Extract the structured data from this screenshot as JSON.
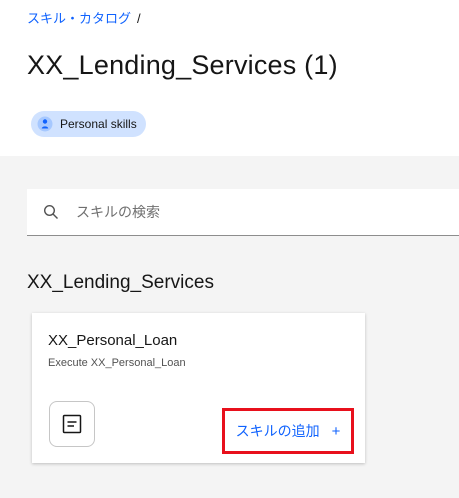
{
  "breadcrumb": {
    "link": "スキル・カタログ",
    "separator": "/"
  },
  "page": {
    "title": "XX_Lending_Services (1)"
  },
  "tag": {
    "label": "Personal skills",
    "icon": "person-icon"
  },
  "search": {
    "placeholder": "スキルの検索",
    "value": "",
    "icon": "search-icon"
  },
  "section": {
    "title": "XX_Lending_Services"
  },
  "card": {
    "title": "XX_Personal_Loan",
    "description": "Execute XX_Personal_Loan",
    "icon": "document-icon",
    "add_label": "スキルの追加",
    "add_icon": "+"
  },
  "colors": {
    "link": "#0f62fe",
    "tag_bg": "#d0e2ff",
    "highlight": "#e8101c",
    "background": "#f4f4f4"
  }
}
